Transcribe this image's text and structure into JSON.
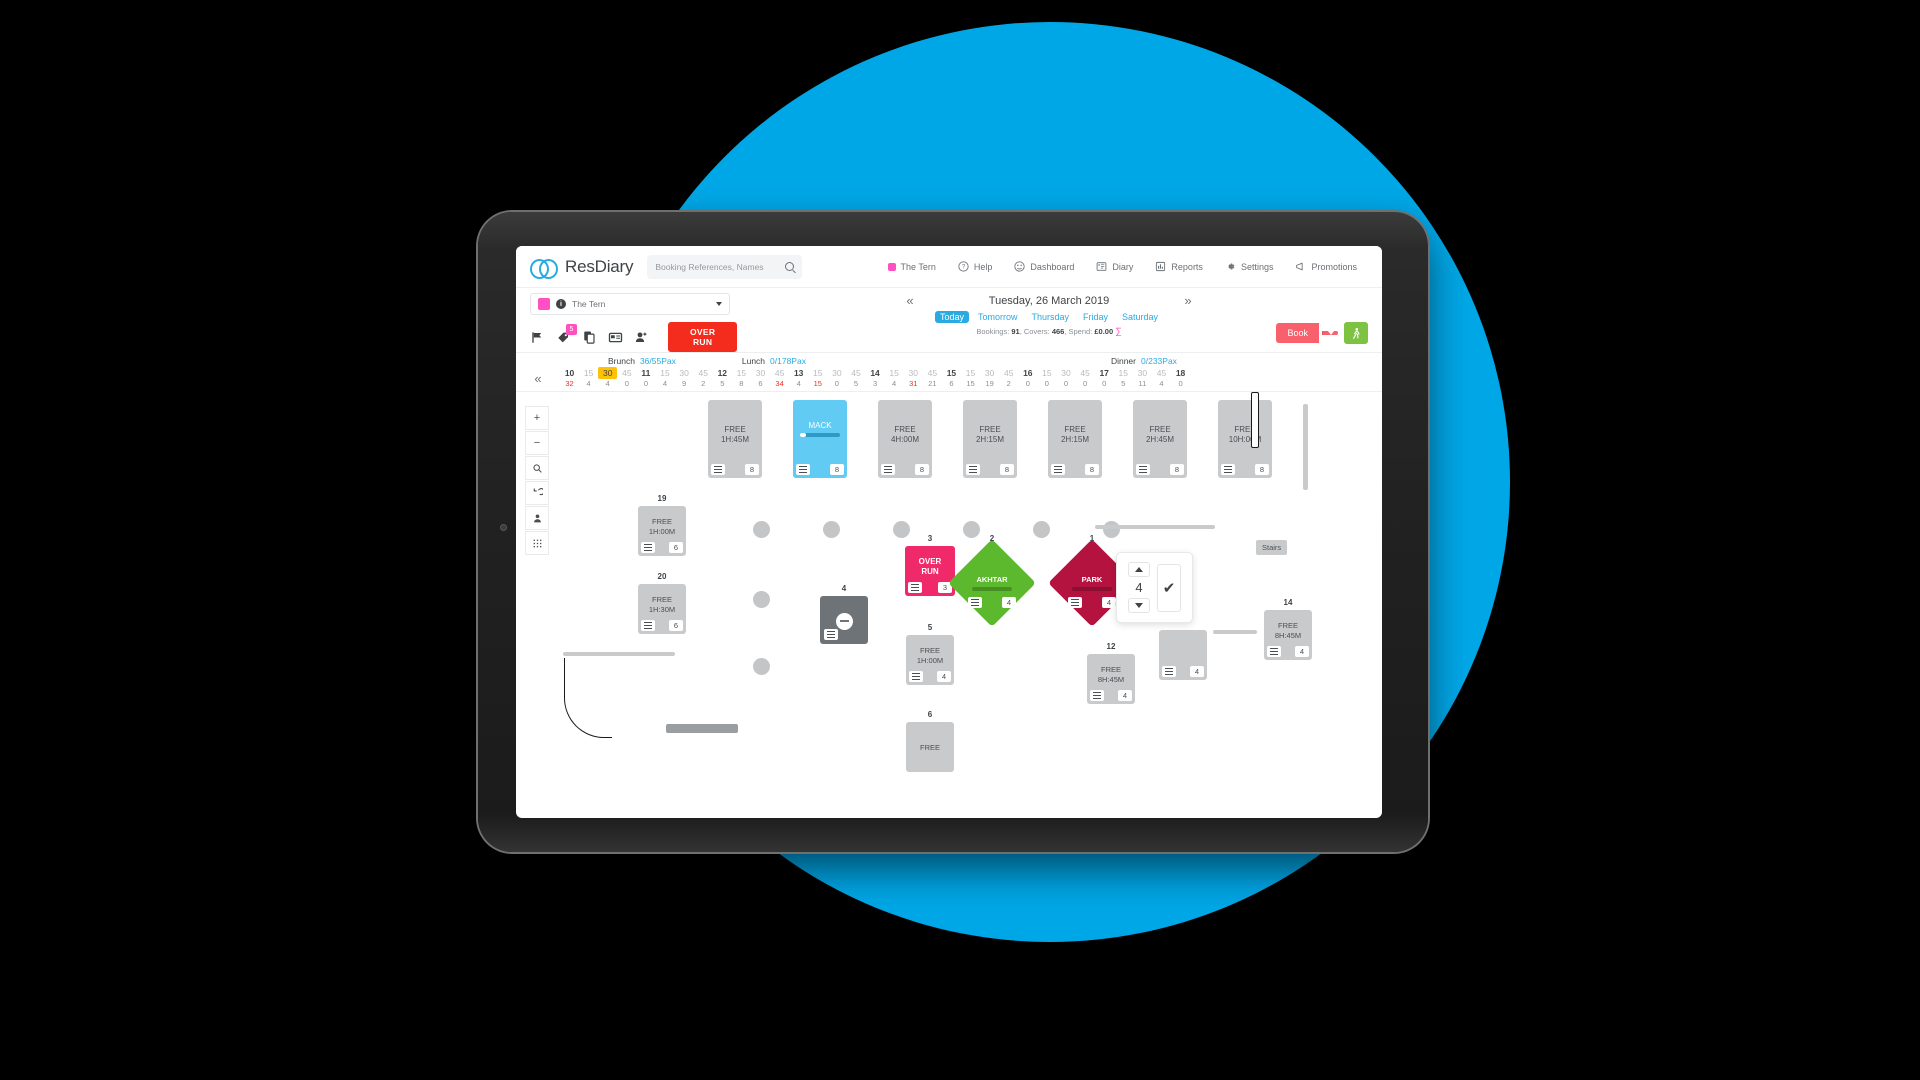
{
  "app": {
    "brand": "ResDiary",
    "search": {
      "placeholder": "Booking References, Names",
      "value": ""
    }
  },
  "nav": [
    {
      "label": "The Tern",
      "icon": "pink-square-icon"
    },
    {
      "label": "Help",
      "icon": "question-circle-icon"
    },
    {
      "label": "Dashboard",
      "icon": "dashboard-icon"
    },
    {
      "label": "Diary",
      "icon": "diary-icon"
    },
    {
      "label": "Reports",
      "icon": "reports-icon"
    },
    {
      "label": "Settings",
      "icon": "gear-icon"
    },
    {
      "label": "Promotions",
      "icon": "megaphone-icon"
    }
  ],
  "toolbar": {
    "venue": "The Tern",
    "venue_color": "#FF4FC0",
    "icons": [
      {
        "name": "flag-icon",
        "badge": ""
      },
      {
        "name": "tag-icon",
        "badge": "5"
      },
      {
        "name": "copy-icon",
        "badge": ""
      },
      {
        "name": "card-icon",
        "badge": ""
      },
      {
        "name": "add-person-icon",
        "badge": ""
      }
    ],
    "overrun_label": "OVER RUN",
    "book_label": "Book",
    "walkin_icon": "walk-in-icon"
  },
  "date": {
    "label": "Tuesday, 26 March 2019",
    "prev_icon": "chevron-double-left-icon",
    "next_icon": "chevron-double-right-icon",
    "tabs": [
      {
        "label": "Today",
        "active": true
      },
      {
        "label": "Tomorrow",
        "active": false
      },
      {
        "label": "Thursday",
        "active": false
      },
      {
        "label": "Friday",
        "active": false
      },
      {
        "label": "Saturday",
        "active": false
      }
    ],
    "stats_prefix": "Bookings: ",
    "bookings": "91",
    "covers_label": ", Covers: ",
    "covers": "466",
    "spend_label": ", Spend: ",
    "spend": "£0.00",
    "sigma": "∑"
  },
  "services": [
    {
      "name": "Brunch",
      "pax": "36/55Pax"
    },
    {
      "name": "Lunch",
      "pax": "0/178Pax"
    },
    {
      "name": "Dinner",
      "pax": "0/233Pax"
    }
  ],
  "ruler": {
    "collapse_icon": "chevron-double-left-icon",
    "times": [
      "10",
      "15",
      "30",
      "45",
      "11",
      "15",
      "30",
      "45",
      "12",
      "15",
      "30",
      "45",
      "13",
      "15",
      "30",
      "45",
      "14",
      "15",
      "30",
      "45",
      "15",
      "15",
      "30",
      "45",
      "16",
      "15",
      "30",
      "45",
      "17",
      "15",
      "30",
      "45",
      "18"
    ],
    "selected_time": "30",
    "selected_index": 2,
    "counts": [
      "32",
      "4",
      "4",
      "0",
      "0",
      "4",
      "9",
      "2",
      "5",
      "8",
      "6",
      "34",
      "4",
      "15",
      "0",
      "5",
      "3",
      "4",
      "31",
      "21",
      "6",
      "15",
      "19",
      "2",
      "0",
      "0",
      "0",
      "0",
      "0",
      "5",
      "11",
      "4",
      "0"
    ],
    "hot_indices": [
      0,
      11,
      13,
      18
    ]
  },
  "tools": [
    {
      "name": "zoom-in-tool",
      "glyph": "+"
    },
    {
      "name": "zoom-out-tool",
      "glyph": "−"
    },
    {
      "name": "search-tool",
      "glyph": "search"
    },
    {
      "name": "undo-tool",
      "glyph": "undo"
    },
    {
      "name": "person-tool",
      "glyph": "person"
    },
    {
      "name": "grid-tool",
      "glyph": "grid"
    }
  ],
  "top_row_cards": [
    {
      "label": "",
      "text": "FREE 1H:45M",
      "covers": "8",
      "state": "free"
    },
    {
      "label": "",
      "text": "MACK",
      "covers": "8",
      "state": "booked",
      "progress": 16
    },
    {
      "label": "",
      "text": "FREE 4H:00M",
      "covers": "8",
      "state": "free"
    },
    {
      "label": "",
      "text": "FREE 2H:15M",
      "covers": "8",
      "state": "free"
    },
    {
      "label": "",
      "text": "FREE 2H:15M",
      "covers": "8",
      "state": "free"
    },
    {
      "label": "",
      "text": "FREE 2H:45M",
      "covers": "8",
      "state": "free"
    },
    {
      "label": "",
      "text": "FREE 10H:00M",
      "covers": "8",
      "state": "free"
    }
  ],
  "floor_cards": [
    {
      "label": "19",
      "line1": "FREE",
      "line2": "1H:00M",
      "covers": "6",
      "state": "free"
    },
    {
      "label": "20",
      "line1": "FREE",
      "line2": "1H:30M",
      "covers": "6",
      "state": "free"
    },
    {
      "label": "4",
      "line1": "",
      "line2": "",
      "covers": "",
      "state": "blocked"
    },
    {
      "label": "5",
      "line1": "FREE",
      "line2": "1H:00M",
      "covers": "4",
      "state": "free"
    },
    {
      "label": "6",
      "line1": "FREE",
      "line2": "",
      "covers": "",
      "state": "free"
    },
    {
      "label": "3",
      "line1": "OVER RUN",
      "line2": "",
      "covers": "3",
      "state": "overrun"
    },
    {
      "label": "12",
      "line1": "FREE",
      "line2": "8H:45M",
      "covers": "4",
      "state": "free"
    },
    {
      "label": "14",
      "line1": "FREE",
      "line2": "8H:45M",
      "covers": "4",
      "state": "free"
    },
    {
      "label": "",
      "line1": "",
      "line2": "",
      "covers": "4",
      "state": "free"
    }
  ],
  "diamonds": [
    {
      "label": "2",
      "name": "AKHTAR",
      "covers": "4",
      "color": "#5CB82C"
    },
    {
      "label": "1",
      "name": "PARK",
      "covers": "4",
      "color": "#B4123F"
    }
  ],
  "stepper": {
    "value": "4",
    "up_icon": "caret-up-icon",
    "down_icon": "caret-down-icon",
    "confirm_icon": "check-icon",
    "confirm_glyph": "✔"
  },
  "stairs_label": "Stairs"
}
